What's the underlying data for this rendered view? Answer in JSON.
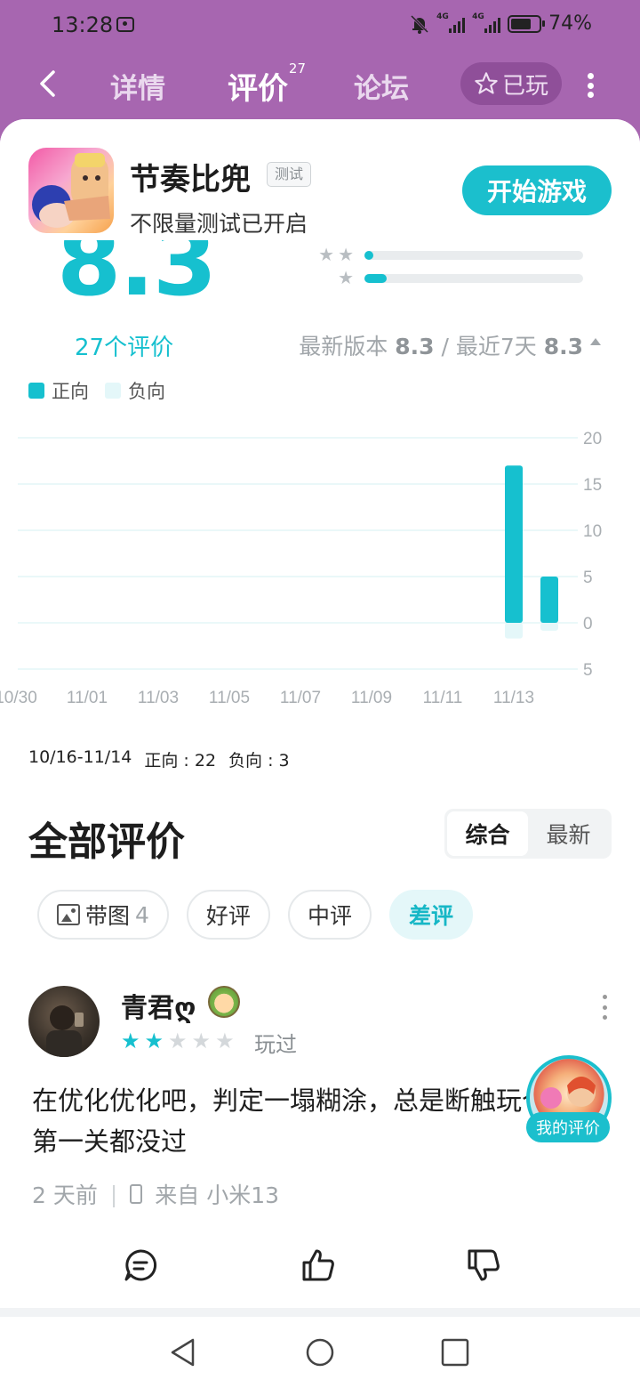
{
  "status": {
    "time": "13:28",
    "network1": "4G",
    "network2": "4G",
    "battery": "74%"
  },
  "nav": {
    "tabs": [
      {
        "label": "详情"
      },
      {
        "label": "评价",
        "count": "27"
      },
      {
        "label": "论坛"
      }
    ],
    "played_label": "已玩"
  },
  "game": {
    "title": "节奏比兜",
    "badge": "测试",
    "subtitle": "不限量测试已开启",
    "play_button": "开始游戏"
  },
  "rating": {
    "score": "8.3",
    "count_link": "27个评价",
    "latest_version_label": "最新版本",
    "latest_version_score": "8.3",
    "separator": "/",
    "recent_label": "最近7天",
    "recent_score": "8.3",
    "star_bars": [
      {
        "stars": "★★",
        "fraction": 0.04
      },
      {
        "stars": "★",
        "fraction": 0.1
      }
    ]
  },
  "legend": {
    "positive": "正向",
    "negative": "负向",
    "positive_color": "#16c0cf",
    "negative_color": "#e4f7f9"
  },
  "chart_data": {
    "type": "bar",
    "x": [
      "10/30",
      "11/01",
      "11/03",
      "11/05",
      "11/07",
      "11/09",
      "11/11",
      "11/13"
    ],
    "y_ticks": [
      "20",
      "15",
      "10",
      "5",
      "0",
      "5"
    ],
    "series": [
      {
        "name": "正向",
        "points": [
          {
            "date": "11/13",
            "value": 17
          },
          {
            "date": "11/14",
            "value": 5
          }
        ]
      },
      {
        "name": "负向",
        "points": [
          {
            "date": "11/13",
            "value": 2
          },
          {
            "date": "11/14",
            "value": 1
          }
        ]
      }
    ],
    "ylim": [
      -5,
      20
    ],
    "grid": true
  },
  "chart_summary": {
    "range": "10/16-11/14",
    "positive": "正向 : 22",
    "negative": "负向 : 3"
  },
  "section": {
    "title": "全部评价",
    "sort_options": [
      "综合",
      "最新"
    ]
  },
  "filters": [
    {
      "label": "带图",
      "count": "4"
    },
    {
      "label": "好评"
    },
    {
      "label": "中评"
    },
    {
      "label": "差评"
    }
  ],
  "review": {
    "user": "青君ღ",
    "rating": 2,
    "played": "玩过",
    "text": "在优化优化吧，判定一塌糊涂，总是断触玩个锤子第一关都没过",
    "time": "2 天前",
    "device": "来自 小米13"
  },
  "my_review_label": "我的评价"
}
